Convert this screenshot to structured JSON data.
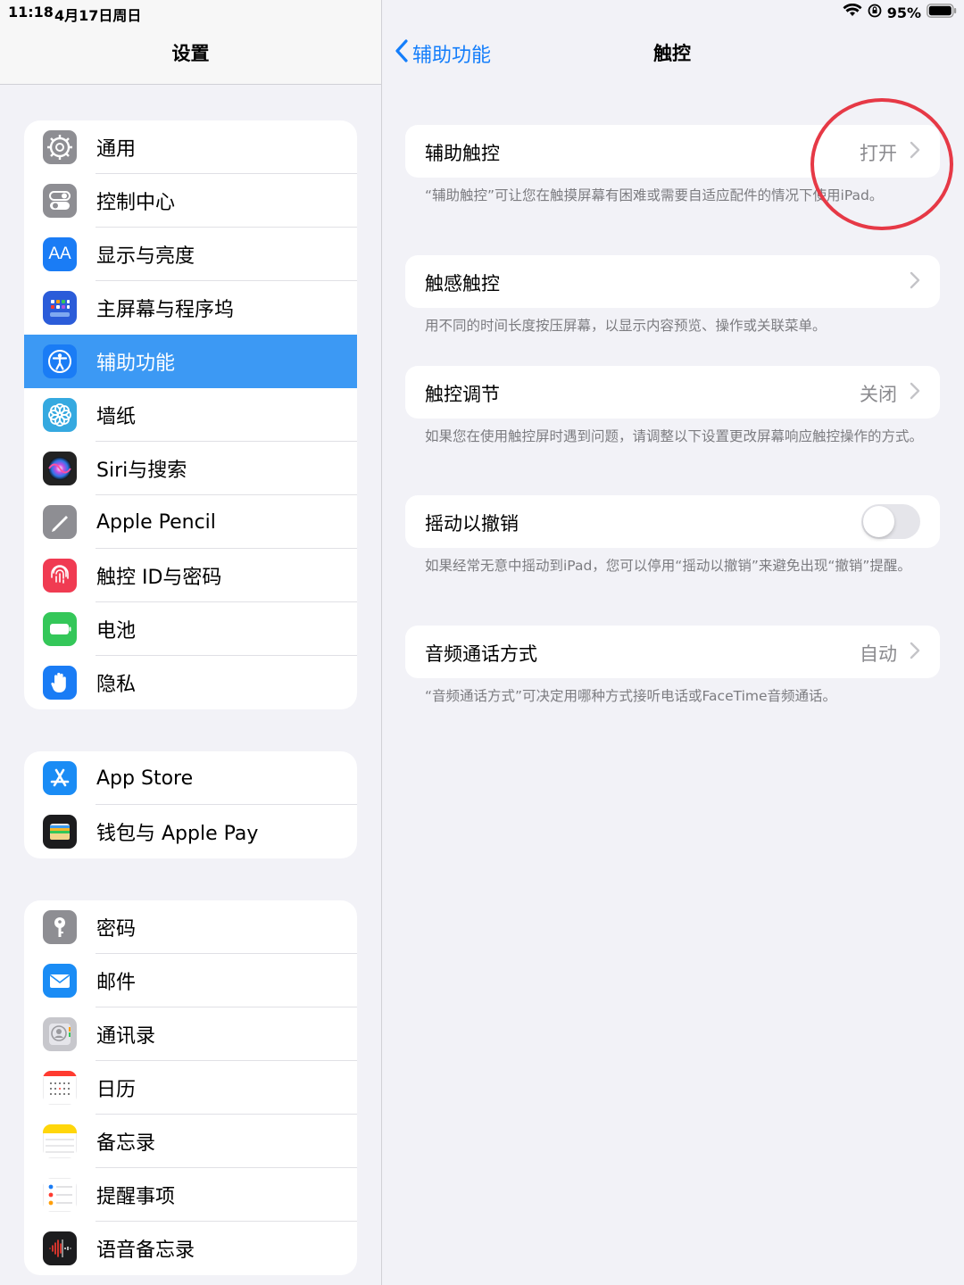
{
  "status_bar": {
    "time": "11:18",
    "date": "4月17日周日",
    "battery": "95%"
  },
  "left": {
    "title": "设置",
    "groups": [
      [
        {
          "label": "通用",
          "icon": "gear-icon",
          "color": "#8e8e93"
        },
        {
          "label": "控制中心",
          "icon": "toggles-icon",
          "color": "#8e8e93"
        },
        {
          "label": "显示与亮度",
          "icon": "text-size-icon",
          "color": "#1a7cf5"
        },
        {
          "label": "主屏幕与程序坞",
          "icon": "home-grid-icon",
          "color": "#2b5cd9"
        },
        {
          "label": "辅助功能",
          "icon": "accessibility-icon",
          "color": "#1a7cf5",
          "selected": true
        },
        {
          "label": "墙纸",
          "icon": "flower-icon",
          "color": "#35a9e0"
        },
        {
          "label": "Siri与搜索",
          "icon": "siri-icon",
          "color": "#222"
        },
        {
          "label": "Apple Pencil",
          "icon": "pencil-icon",
          "color": "#8e8e93"
        },
        {
          "label": "触控 ID与密码",
          "icon": "fingerprint-icon",
          "color": "#f03b52"
        },
        {
          "label": "电池",
          "icon": "battery-icon",
          "color": "#34c759"
        },
        {
          "label": "隐私",
          "icon": "hand-icon",
          "color": "#1a7cf5"
        }
      ],
      [
        {
          "label": "App Store",
          "icon": "app-store-icon",
          "color": "#1a8cf5"
        },
        {
          "label": "钱包与 Apple Pay",
          "icon": "wallet-icon",
          "color": "#1c1c1e"
        }
      ],
      [
        {
          "label": "密码",
          "icon": "key-icon",
          "color": "#8e8e93"
        },
        {
          "label": "邮件",
          "icon": "mail-icon",
          "color": "#1a8cf5"
        },
        {
          "label": "通讯录",
          "icon": "contacts-icon",
          "color": "#c7c7cc"
        },
        {
          "label": "日历",
          "icon": "calendar-icon",
          "color": "#ffffff"
        },
        {
          "label": "备忘录",
          "icon": "notes-icon",
          "color": "#ffffff"
        },
        {
          "label": "提醒事项",
          "icon": "reminders-icon",
          "color": "#ffffff"
        },
        {
          "label": "语音备忘录",
          "icon": "voice-memo-icon",
          "color": "#1c1c1e"
        }
      ]
    ]
  },
  "right": {
    "back_label": "辅助功能",
    "title": "触控",
    "cards": [
      {
        "label": "辅助触控",
        "value": "打开",
        "type": "chevron",
        "note": "“辅助触控”可让您在触摸屏幕有困难或需要自适应配件的情况下使用iPad。"
      },
      {
        "label": "触感触控",
        "value": "",
        "type": "chevron",
        "note": "用不同的时间长度按压屏幕，以显示内容预览、操作或关联菜单。"
      },
      {
        "label": "触控调节",
        "value": "关闭",
        "type": "chevron",
        "note": "如果您在使用触控屏时遇到问题，请调整以下设置更改屏幕响应触控操作的方式。"
      },
      {
        "label": "摇动以撤销",
        "value": "",
        "type": "toggle",
        "on": false,
        "note": "如果经常无意中摇动到iPad，您可以停用“摇动以撤销”来避免出现“撤销”提醒。"
      },
      {
        "label": "音频通话方式",
        "value": "自动",
        "type": "chevron",
        "note": "“音频通话方式”可决定用哪种方式接听电话或FaceTime音频通话。"
      }
    ]
  },
  "colors": {
    "accent": "#147efb",
    "selected_row": "#3c99f4",
    "annotation": "#e63946"
  }
}
